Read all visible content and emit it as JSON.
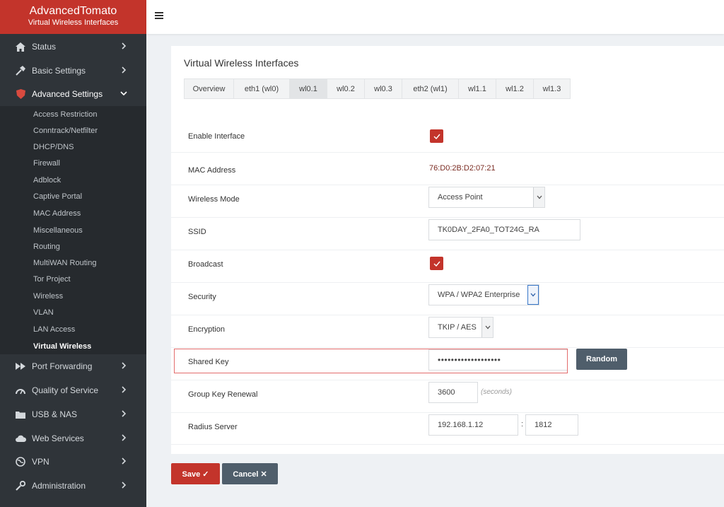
{
  "brand": {
    "name": "AdvancedTomato",
    "subtitle": "Virtual Wireless Interfaces"
  },
  "nav": {
    "status": "Status",
    "basic": "Basic Settings",
    "advanced": "Advanced Settings",
    "port_forwarding": "Port Forwarding",
    "qos": "Quality of Service",
    "usb": "USB & NAS",
    "web": "Web Services",
    "vpn": "VPN",
    "admin": "Administration"
  },
  "advanced_sub": [
    "Access Restriction",
    "Conntrack/Netfilter",
    "DHCP/DNS",
    "Firewall",
    "Adblock",
    "Captive Portal",
    "MAC Address",
    "Miscellaneous",
    "Routing",
    "MultiWAN Routing",
    "Tor Project",
    "Wireless",
    "VLAN",
    "LAN Access",
    "Virtual Wireless"
  ],
  "card": {
    "title": "Virtual Wireless Interfaces"
  },
  "tabs": [
    "Overview",
    "eth1 (wl0)",
    "wl0.1",
    "wl0.2",
    "wl0.3",
    "eth2 (wl1)",
    "wl1.1",
    "wl1.2",
    "wl1.3"
  ],
  "form": {
    "enable_label": "Enable Interface",
    "enable_checked": true,
    "mac_label": "MAC Address",
    "mac_value": "76:D0:2B:D2:07:21",
    "mode_label": "Wireless Mode",
    "mode_value": "Access Point",
    "ssid_label": "SSID",
    "ssid_value": "TK0DAY_2FA0_TOT24G_RA",
    "broadcast_label": "Broadcast",
    "broadcast_checked": true,
    "security_label": "Security",
    "security_value": "WPA / WPA2 Enterprise",
    "encryption_label": "Encryption",
    "encryption_value": "TKIP / AES",
    "shared_key_label": "Shared Key",
    "shared_key_value": "•••••••••••••••••••",
    "random_label": "Random",
    "renewal_label": "Group Key Renewal",
    "renewal_value": "3600",
    "renewal_unit": "(seconds)",
    "radius_label": "Radius Server",
    "radius_ip": "192.168.1.12",
    "radius_sep": ":",
    "radius_port": "1812"
  },
  "actions": {
    "save": "Save ✓",
    "cancel": "Cancel ✕"
  },
  "colors": {
    "accent": "#c3342b",
    "sidebar": "#2f3439",
    "button_dark": "#4f5e6b"
  }
}
